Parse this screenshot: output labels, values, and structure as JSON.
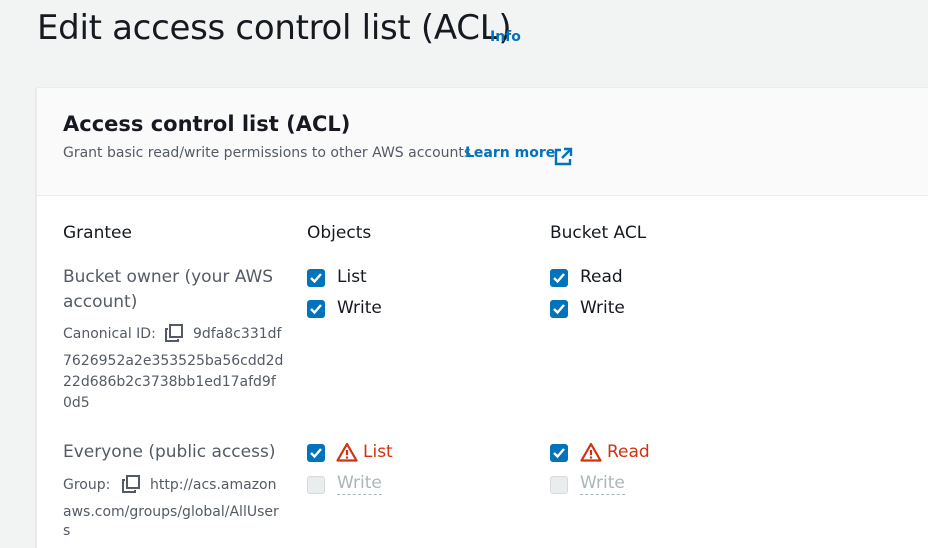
{
  "page": {
    "title": "Edit access control list (ACL)",
    "info_link": "Info"
  },
  "panel": {
    "title": "Access control list (ACL)",
    "description": "Grant basic read/write permissions to other AWS accounts.",
    "learn_more": "Learn more"
  },
  "columns": {
    "grantee": "Grantee",
    "objects": "Objects",
    "bucket_acl": "Bucket ACL"
  },
  "owner": {
    "name": "Bucket owner (your AWS account)",
    "id_label": "Canonical ID:",
    "id_lines": [
      "9dfa8c331df",
      "7626952a2e353525ba56cdd2d",
      "22d686b2c3738bb1ed17afd9f",
      "0d5"
    ],
    "objects_list": "List",
    "objects_write": "Write",
    "acl_read": "Read",
    "acl_write": "Write"
  },
  "everyone": {
    "name": "Everyone (public access)",
    "group_label": "Group:",
    "group_lines": [
      "http://acs.amazon",
      "aws.com/groups/global/AllUser",
      "s"
    ],
    "objects_list": "List",
    "objects_write": "Write",
    "acl_read": "Read",
    "acl_write": "Write"
  },
  "colors": {
    "link": "#0073bb",
    "checkbox": "#0073bb",
    "warning": "#d13212",
    "disabled": "#aab7b8"
  }
}
